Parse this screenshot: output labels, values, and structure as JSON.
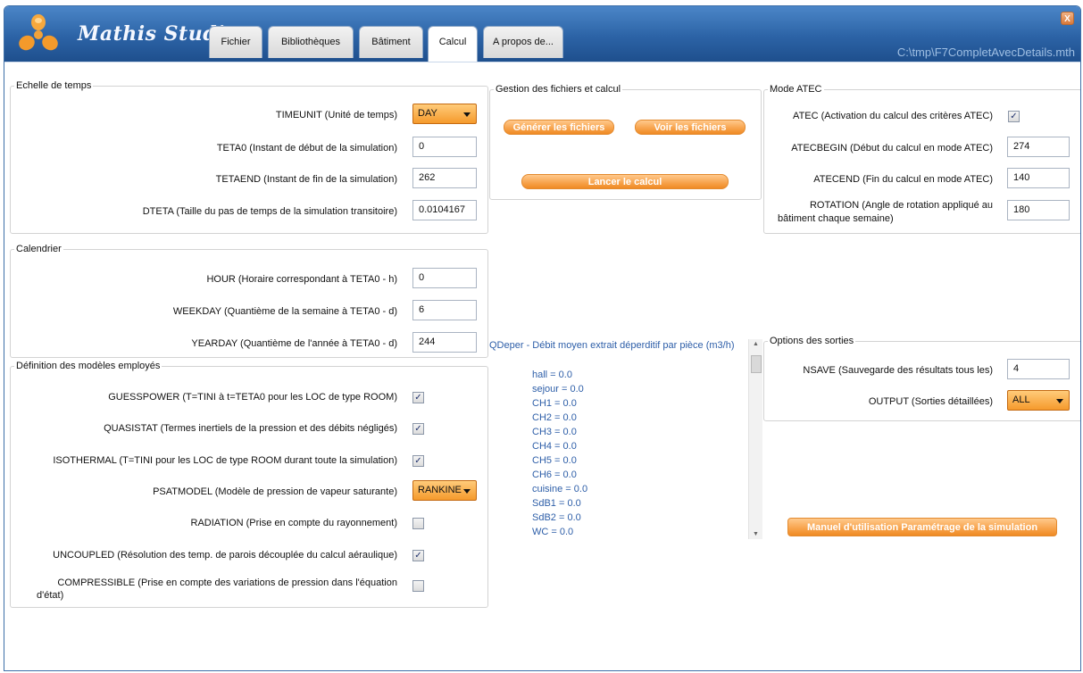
{
  "app": {
    "title": "Mathis Studio",
    "file_path": "C:\\tmp\\F7CompletAvecDetails.mth",
    "close_label": "X"
  },
  "tabs": [
    {
      "label": "Fichier"
    },
    {
      "label": "Bibliothèques"
    },
    {
      "label": "Bâtiment"
    },
    {
      "label": "Calcul",
      "active": true
    },
    {
      "label": "A propos de..."
    }
  ],
  "echelle": {
    "legend": "Echelle de temps",
    "timeunit_label": "TIMEUNIT (Unité de temps)",
    "timeunit_value": "DAY",
    "teta0_label": "TETA0 (Instant de début de la simulation)",
    "teta0_value": "0",
    "tetaend_label": "TETAEND (Instant de fin de la simulation)",
    "tetaend_value": "262",
    "dteta_label": "DTETA (Taille du pas de temps de la simulation transitoire)",
    "dteta_value": "0.0104167"
  },
  "calendrier": {
    "legend": "Calendrier",
    "hour_label": "HOUR (Horaire correspondant à TETA0 - h)",
    "hour_value": "0",
    "weekday_label": "WEEKDAY (Quantième de la semaine à TETA0 - d)",
    "weekday_value": "6",
    "yearday_label": "YEARDAY (Quantième de l'année à TETA0 - d)",
    "yearday_value": "244"
  },
  "modeles": {
    "legend": "Définition des modèles employés",
    "guesspower_label": "GUESSPOWER (T=TINI à t=TETA0 pour les LOC de type ROOM)",
    "guesspower_checked": true,
    "quasistat_label": "QUASISTAT (Termes inertiels de la pression et des débits négligés)",
    "quasistat_checked": true,
    "isothermal_label": "ISOTHERMAL (T=TINI pour les LOC de type ROOM durant toute la simulation)",
    "isothermal_checked": true,
    "psatmodel_label": "PSATMODEL (Modèle de pression de vapeur saturante)",
    "psatmodel_value": "RANKINE",
    "radiation_label": "RADIATION (Prise en compte du rayonnement)",
    "radiation_checked": false,
    "uncoupled_label": "UNCOUPLED (Résolution des temp. de parois découplée du calcul aéraulique)",
    "uncoupled_checked": true,
    "compressible_label_line1": "COMPRESSIBLE (Prise en compte des variations de pression dans l'équation",
    "compressible_label_line2": "d'état)",
    "compressible_checked": false
  },
  "gestion": {
    "legend": "Gestion des fichiers et calcul",
    "generate_label": "Générer les fichiers",
    "view_label": "Voir les fichiers",
    "run_label": "Lancer le calcul"
  },
  "atec": {
    "legend": "Mode ATEC",
    "atec_label": "ATEC (Activation du calcul des critères ATEC)",
    "atec_checked": true,
    "atecbegin_label": "ATECBEGIN (Début du calcul en mode ATEC)",
    "atecbegin_value": "274",
    "atecend_label": "ATECEND (Fin du calcul en mode ATEC)",
    "atecend_value": "140",
    "rotation_label_line1": "ROTATION (Angle de rotation appliqué au",
    "rotation_label_line2": "bâtiment chaque semaine)",
    "rotation_value": "180"
  },
  "qdeper": {
    "title": "QDeper - Débit moyen extrait déperditif par pièce (m3/h)",
    "lines": [
      "hall = 0.0",
      "sejour = 0.0",
      "CH1 = 0.0",
      "CH2 = 0.0",
      "CH3 = 0.0",
      "CH4 = 0.0",
      "CH5 = 0.0",
      "CH6 = 0.0",
      "cuisine = 0.0",
      "SdB1 = 0.0",
      "SdB2 = 0.0",
      "WC = 0.0"
    ]
  },
  "sorties": {
    "legend": "Options des sorties",
    "nsave_label": "NSAVE (Sauvegarde des résultats tous les)",
    "nsave_value": "4",
    "output_label": "OUTPUT (Sorties détaillées)",
    "output_value": "ALL"
  },
  "manual_button_label": "Manuel d'utilisation Paramétrage de la simulation"
}
